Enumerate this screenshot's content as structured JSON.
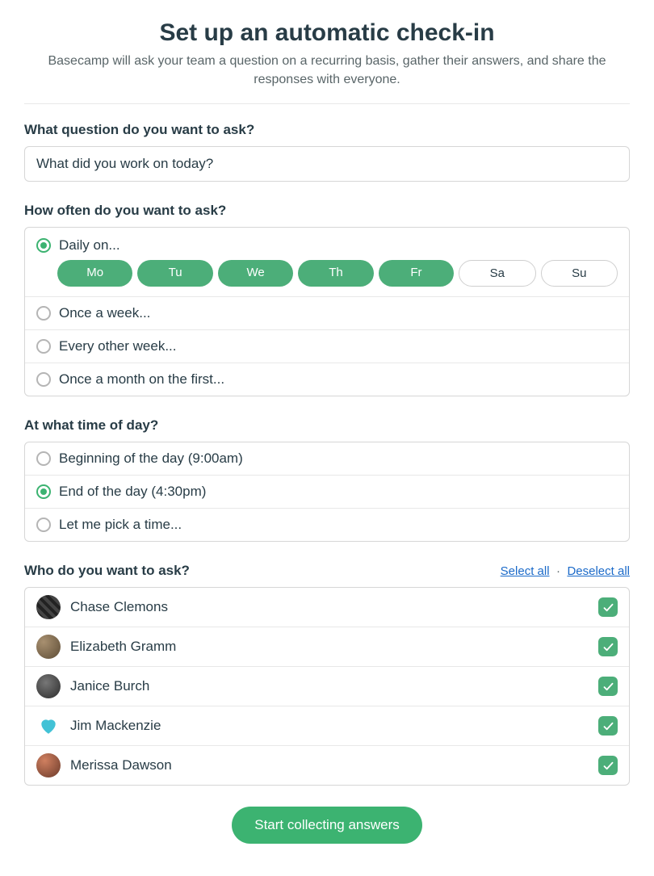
{
  "header": {
    "title": "Set up an automatic check-in",
    "subtitle": "Basecamp will ask your team a question on a recurring basis, gather their answers, and share the responses with everyone."
  },
  "question": {
    "label": "What question do you want to ask?",
    "value": "What did you work on today?"
  },
  "frequency": {
    "label": "How often do you want to ask?",
    "options": {
      "daily": {
        "label": "Daily on...",
        "selected": true
      },
      "weekly": {
        "label": "Once a week...",
        "selected": false
      },
      "biweekly": {
        "label": "Every other week...",
        "selected": false
      },
      "monthly": {
        "label": "Once a month on the first...",
        "selected": false
      }
    },
    "days": [
      {
        "abbr": "Mo",
        "on": true
      },
      {
        "abbr": "Tu",
        "on": true
      },
      {
        "abbr": "We",
        "on": true
      },
      {
        "abbr": "Th",
        "on": true
      },
      {
        "abbr": "Fr",
        "on": true
      },
      {
        "abbr": "Sa",
        "on": false
      },
      {
        "abbr": "Su",
        "on": false
      }
    ]
  },
  "time": {
    "label": "At what time of day?",
    "options": {
      "beginning": {
        "label": "Beginning of the day (9:00am)",
        "selected": false
      },
      "end": {
        "label": "End of the day (4:30pm)",
        "selected": true
      },
      "pick": {
        "label": "Let me pick a time...",
        "selected": false
      }
    }
  },
  "who": {
    "label": "Who do you want to ask?",
    "select_all": "Select all",
    "deselect_all": "Deselect all",
    "separator": "·",
    "people": [
      {
        "name": "Chase Clemons",
        "avatar": "cc",
        "checked": true
      },
      {
        "name": "Elizabeth Gramm",
        "avatar": "eg",
        "checked": true
      },
      {
        "name": "Janice Burch",
        "avatar": "jb",
        "checked": true
      },
      {
        "name": "Jim Mackenzie",
        "avatar": "jm",
        "checked": true
      },
      {
        "name": "Merissa Dawson",
        "avatar": "md",
        "checked": true
      }
    ]
  },
  "submit": {
    "label": "Start collecting answers"
  },
  "colors": {
    "accent": "#3cb371",
    "accent2": "#4cae79",
    "link": "#1b6ac9"
  }
}
